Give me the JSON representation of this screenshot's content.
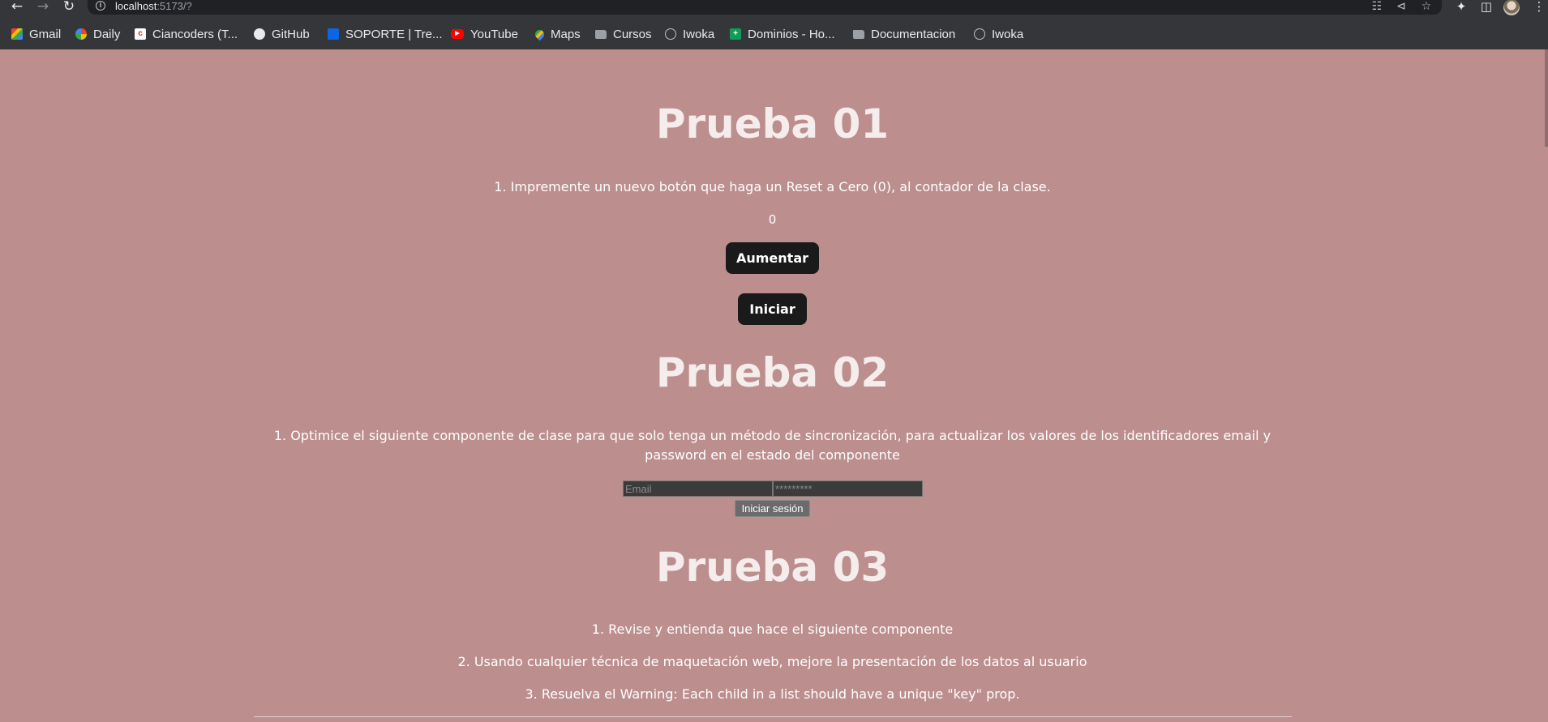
{
  "browser": {
    "url_host": "localhost",
    "url_path": ":5173/?",
    "bookmarks": [
      {
        "label": "Gmail",
        "icon": "gmail-icon"
      },
      {
        "label": "Daily",
        "icon": "daily-icon"
      },
      {
        "label": "Ciancoders (T...",
        "icon": "ciancoders-icon"
      },
      {
        "label": "GitHub",
        "icon": "github-icon"
      },
      {
        "label": "SOPORTE | Tre...",
        "icon": "trello-icon"
      },
      {
        "label": "YouTube",
        "icon": "youtube-icon"
      },
      {
        "label": "Maps",
        "icon": "maps-icon"
      },
      {
        "label": "Cursos",
        "icon": "folder-icon"
      },
      {
        "label": "Iwoka",
        "icon": "globe-icon"
      },
      {
        "label": "Dominios - Ho...",
        "icon": "sheets-icon"
      },
      {
        "label": "Documentacion",
        "icon": "folder-icon"
      },
      {
        "label": "Iwoka",
        "icon": "globe-icon"
      }
    ]
  },
  "prueba01": {
    "title": "Prueba 01",
    "instruction": "1. Impremente un nuevo botón que haga un Reset a Cero (0), al contador de la clase.",
    "counter": "0",
    "increment_label": "Aumentar",
    "start_label": "Iniciar"
  },
  "prueba02": {
    "title": "Prueba 02",
    "instruction": "1. Optimice el siguiente componente de clase para que solo tenga un método de sincronización, para actualizar los valores de los identificadores email y password en el estado del componente",
    "email_placeholder": "Email",
    "password_placeholder": "*********",
    "login_label": "Iniciar sesión"
  },
  "prueba03": {
    "title": "Prueba 03",
    "items": [
      "1. Revise y entienda que hace el siguiente componente",
      "2. Usando cualquier técnica de maquetación web, mejore la presentación de los datos al usuario",
      "3. Resuelva el Warning: Each child in a list should have a unique \"key\" prop."
    ]
  },
  "colors": {
    "page_background": "#bc8e8e",
    "button_dark": "#1a1a1a",
    "chrome_dark": "#35363a"
  }
}
